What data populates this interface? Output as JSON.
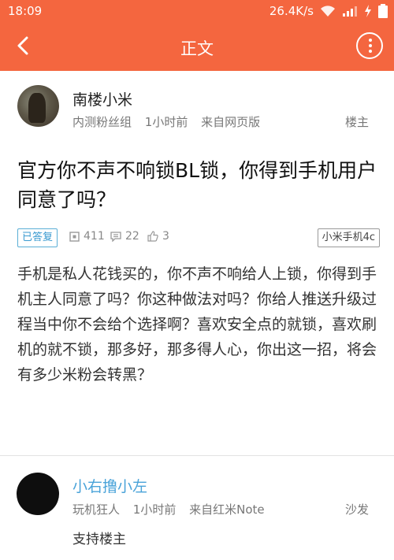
{
  "status_bar": {
    "time": "18:09",
    "speed": "26.4K/s"
  },
  "app_bar": {
    "title": "正文"
  },
  "post": {
    "author": "南楼小米",
    "group": "内测粉丝组",
    "time": "1小时前",
    "source": "来自网页版",
    "floor": "楼主",
    "title": "官方你不声不响锁BL锁，你得到手机用户同意了吗？",
    "status_badge": "已答复",
    "views": "411",
    "comments": "22",
    "likes": "3",
    "device_tag": "小米手机4c",
    "body": "手机是私人花钱买的，你不声不响给人上锁，你得到手机主人同意了吗？你这种做法对吗？你给人推送升级过程当中你不会给个选择啊？喜欢安全点的就锁，喜欢刷机的就不锁，那多好，那多得人心，你出这一招，将会有多少米粉会转黑？"
  },
  "reply": {
    "author": "小右撸小左",
    "group": "玩机狂人",
    "time": "1小时前",
    "source": "来自红米Note",
    "floor": "沙发",
    "text": "支持楼主"
  },
  "colors": {
    "accent": "#f4663f",
    "link": "#4aa3d9"
  }
}
